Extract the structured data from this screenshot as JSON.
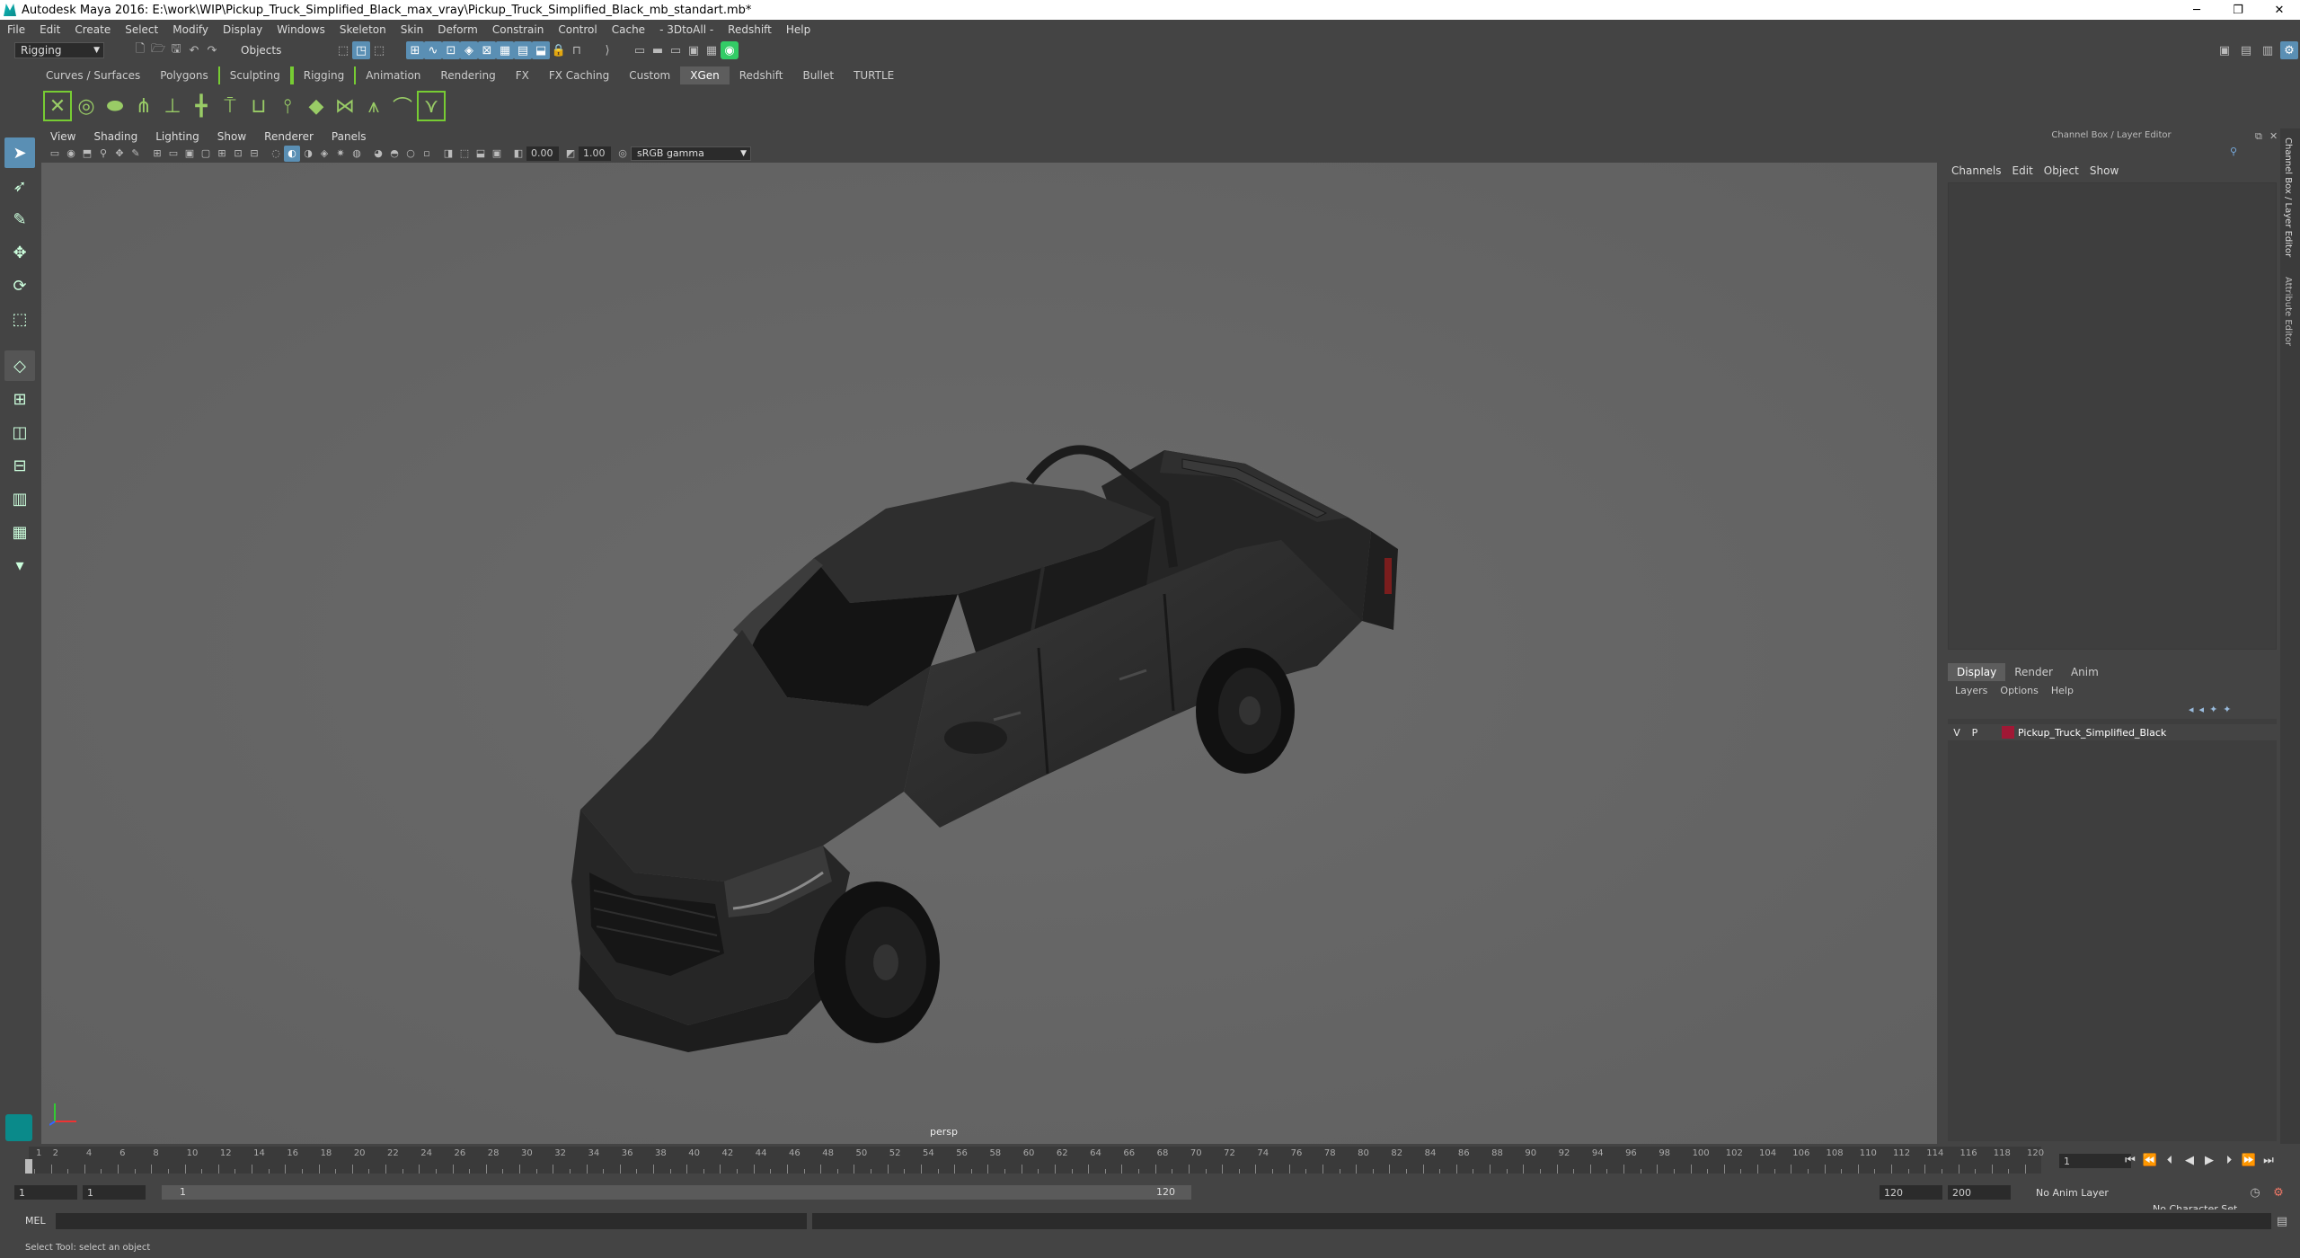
{
  "window": {
    "title": "Autodesk Maya 2016: E:\\work\\WIP\\Pickup_Truck_Simplified_Black_max_vray\\Pickup_Truck_Simplified_Black_mb_standart.mb*",
    "minimize": "─",
    "restore": "❐",
    "close": "✕"
  },
  "menubar": [
    "File",
    "Edit",
    "Create",
    "Select",
    "Modify",
    "Display",
    "Windows",
    "Skeleton",
    "Skin",
    "Deform",
    "Constrain",
    "Control",
    "Cache",
    "- 3DtoAll -",
    "Redshift",
    "Help"
  ],
  "statusline": {
    "menuset": "Rigging",
    "selection_mode": "Objects"
  },
  "shelf_tabs": [
    "Curves / Surfaces",
    "Polygons",
    "Sculpting",
    "Rigging",
    "Animation",
    "Rendering",
    "FX",
    "FX Caching",
    "Custom",
    "XGen",
    "Redshift",
    "Bullet",
    "TURTLE"
  ],
  "active_shelf_tab": "XGen",
  "viewport": {
    "menu": [
      "View",
      "Shading",
      "Lighting",
      "Show",
      "Renderer",
      "Panels"
    ],
    "exposure": "0.00",
    "gamma": "1.00",
    "color_space": "sRGB gamma",
    "camera_label": "persp"
  },
  "channel_box": {
    "title": "Channel Box / Layer Editor",
    "menu": [
      "Channels",
      "Edit",
      "Object",
      "Show"
    ]
  },
  "side_tabs": [
    "Channel Box / Layer Editor",
    "Attribute Editor"
  ],
  "layer_editor": {
    "tabs": [
      "Display",
      "Render",
      "Anim"
    ],
    "active_tab": "Display",
    "menu": [
      "Layers",
      "Options",
      "Help"
    ],
    "layers": [
      {
        "visible": "V",
        "playback": "P",
        "color": "#a01835",
        "name": "Pickup_Truck_Simplified_Black"
      }
    ]
  },
  "timeline": {
    "ticks": [
      "1",
      "2",
      "4",
      "6",
      "8",
      "10",
      "12",
      "14",
      "16",
      "18",
      "20",
      "22",
      "24",
      "26",
      "28",
      "30",
      "32",
      "34",
      "36",
      "38",
      "40",
      "42",
      "44",
      "46",
      "48",
      "50",
      "52",
      "54",
      "56",
      "58",
      "60",
      "62",
      "64",
      "66",
      "68",
      "70",
      "72",
      "74",
      "76",
      "78",
      "80",
      "82",
      "84",
      "86",
      "88",
      "90",
      "92",
      "94",
      "96",
      "98",
      "100",
      "102",
      "104",
      "106",
      "108",
      "110",
      "112",
      "114",
      "116",
      "118",
      "120"
    ],
    "current_frame": "1"
  },
  "range": {
    "start": "1",
    "playback_start": "1",
    "slider_start": "1",
    "slider_end": "120",
    "playback_end": "120",
    "end": "200",
    "anim_layer": "No Anim Layer",
    "character_set": "No Character Set"
  },
  "command_line": {
    "label": "MEL"
  },
  "help_line": "Select Tool: select an object"
}
